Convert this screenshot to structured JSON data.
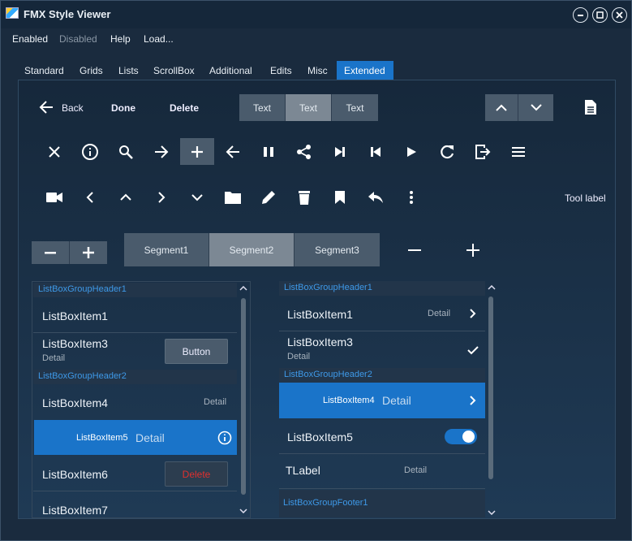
{
  "window": {
    "title": "FMX Style Viewer"
  },
  "menu": {
    "enabled": "Enabled",
    "disabled": "Disabled",
    "help": "Help",
    "load": "Load..."
  },
  "tabs": [
    "Standard",
    "Grids",
    "Lists",
    "ScrollBox",
    "Additional",
    "Edits",
    "Misc",
    "Extended"
  ],
  "toolbar": {
    "back": "Back",
    "done": "Done",
    "delete": "Delete",
    "text1": "Text",
    "text2": "Text",
    "text3": "Text",
    "tool_label": "Tool label"
  },
  "segments": {
    "s1": "Segment1",
    "s2": "Segment2",
    "s3": "Segment3"
  },
  "listbox1": {
    "h1": "ListBoxGroupHeader1",
    "i1": "ListBoxItem1",
    "i3": "ListBoxItem3",
    "i3d": "Detail",
    "button": "Button",
    "h2": "ListBoxGroupHeader2",
    "i4": "ListBoxItem4",
    "i4d": "Detail",
    "i5": "ListBoxItem5",
    "i5d": "Detail",
    "i6": "ListBoxItem6",
    "delete": "Delete",
    "i7": "ListBoxItem7"
  },
  "listbox2": {
    "h1": "ListBoxGroupHeader1",
    "i1": "ListBoxItem1",
    "i1d": "Detail",
    "i3": "ListBoxItem3",
    "i3d": "Detail",
    "h2": "ListBoxGroupHeader2",
    "i4": "ListBoxItem4",
    "i4d": "Detail",
    "i5": "ListBoxItem5",
    "tlabel": "TLabel",
    "tlabeld": "Detail",
    "f1": "ListBoxGroupFooter1"
  },
  "colors": {
    "accent": "#1a74c9",
    "delete": "#e0302e",
    "header": "#3e99e8"
  }
}
